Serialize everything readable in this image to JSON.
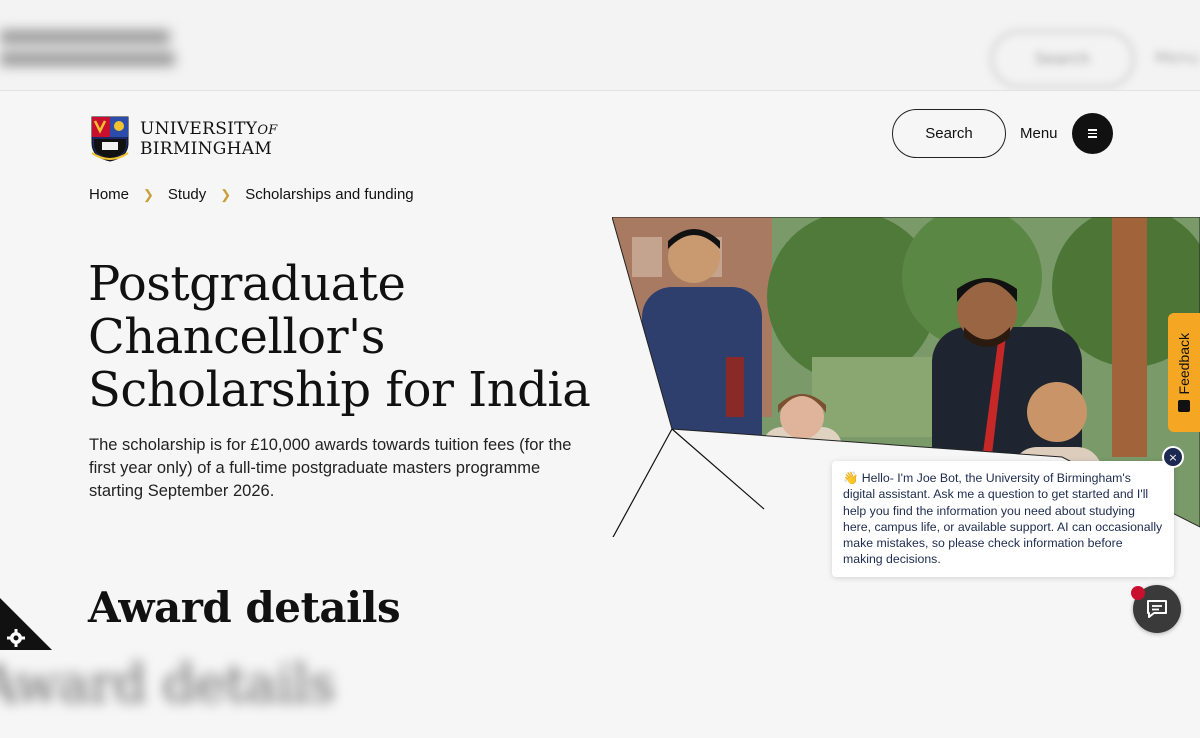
{
  "header": {
    "logo_line1": "UNIVERSITY",
    "logo_of": "OF",
    "logo_line2": "BIRMINGHAM",
    "search_label": "Search",
    "menu_label": "Menu"
  },
  "breadcrumb": [
    "Home",
    "Study",
    "Scholarships and funding"
  ],
  "hero": {
    "title": "Postgraduate Chancellor's Scholarship for India",
    "description": "The scholarship is for £10,000 awards towards tuition fees (for the first year only) of a full-time postgraduate masters programme starting September 2026."
  },
  "section": {
    "award_title": "Award details"
  },
  "feedback": {
    "label": "Feedback"
  },
  "chat": {
    "message": "👋 Hello- I'm Joe Bot, the University of Birmingham's digital assistant. Ask me a question to get started and I'll help you find the information you need about studying here, campus life, or available support. AI can occasionally make mistakes, so please check information before making decisions.",
    "close_label": "×"
  },
  "colors": {
    "accent_gold": "#c8a03a",
    "feedback_orange": "#f5a623",
    "chat_navy": "#1c2a52",
    "notification_red": "#c8102e"
  }
}
